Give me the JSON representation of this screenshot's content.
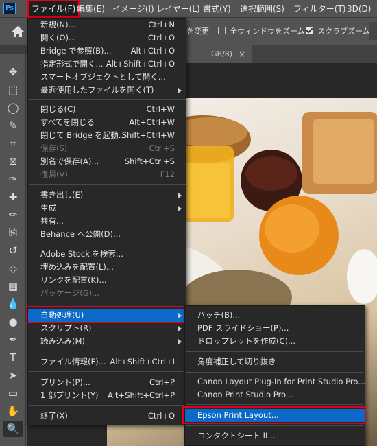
{
  "app": {
    "logo": "Ps"
  },
  "menubar": {
    "items": [
      "ファイル(F)",
      "編集(E)",
      "イメージ(I)",
      "レイヤー(L)",
      "書式(Y)",
      "選択範囲(S)",
      "フィルター(T)",
      "3D(D)"
    ],
    "active_index": 0
  },
  "options": {
    "home_icon": "home-icon",
    "partial_text": "を変更",
    "zoom_all_windows": {
      "label": "全ウィンドウをズーム",
      "checked": false
    },
    "scrubby_zoom": {
      "label": "スクラブズーム",
      "checked": true
    }
  },
  "document": {
    "tab_partial_title": "GB/8)",
    "close_glyph": "×"
  },
  "tools": [
    "move-tool",
    "marquee-tool",
    "lasso-tool",
    "quick-selection-tool",
    "crop-tool",
    "frame-tool",
    "eyedropper-tool",
    "healing-brush-tool",
    "brush-tool",
    "clone-stamp-tool",
    "history-brush-tool",
    "eraser-tool",
    "gradient-tool",
    "blur-tool",
    "dodge-tool",
    "pen-tool",
    "type-tool",
    "path-selection-tool",
    "rectangle-tool",
    "hand-tool",
    "zoom-tool"
  ],
  "tool_glyphs": [
    "✥",
    "⬚",
    "◯",
    "✎",
    "⌗",
    "⊠",
    "✑",
    "✚",
    "✏",
    "⎘",
    "↺",
    "◇",
    "▦",
    "💧",
    "●",
    "✒",
    "T",
    "➤",
    "▭",
    "✋",
    "🔍"
  ],
  "selected_tool": "zoom-tool",
  "file_menu": {
    "items": [
      {
        "label": "新規(N)...",
        "shortcut": "Ctrl+N"
      },
      {
        "label": "開く(O)...",
        "shortcut": "Ctrl+O"
      },
      {
        "label": "Bridge で参照(B)...",
        "shortcut": "Alt+Ctrl+O"
      },
      {
        "label": "指定形式で開く...",
        "shortcut": "Alt+Shift+Ctrl+O"
      },
      {
        "label": "スマートオブジェクトとして開く..."
      },
      {
        "label": "最近使用したファイルを開く(T)",
        "submenu": true
      },
      {
        "label": "閉じる(C)",
        "shortcut": "Ctrl+W"
      },
      {
        "label": "すべてを閉じる",
        "shortcut": "Alt+Ctrl+W"
      },
      {
        "label": "閉じて Bridge を起動...",
        "shortcut": "Shift+Ctrl+W"
      },
      {
        "label": "保存(S)",
        "shortcut": "Ctrl+S",
        "disabled": true
      },
      {
        "label": "別名で保存(A)...",
        "shortcut": "Shift+Ctrl+S"
      },
      {
        "label": "復帰(V)",
        "shortcut": "F12",
        "disabled": true
      },
      {
        "label": "書き出し(E)",
        "submenu": true
      },
      {
        "label": "生成",
        "submenu": true
      },
      {
        "label": "共有..."
      },
      {
        "label": "Behance へ公開(D)..."
      },
      {
        "label": "Adobe Stock を検索..."
      },
      {
        "label": "埋め込みを配置(L)..."
      },
      {
        "label": "リンクを配置(K)..."
      },
      {
        "label": "パッケージ(G)...",
        "disabled": true
      },
      {
        "label": "自動処理(U)",
        "submenu": true,
        "highlighted": true
      },
      {
        "label": "スクリプト(R)",
        "submenu": true
      },
      {
        "label": "読み込み(M)",
        "submenu": true
      },
      {
        "label": "ファイル情報(F)...",
        "shortcut": "Alt+Shift+Ctrl+I"
      },
      {
        "label": "プリント(P)...",
        "shortcut": "Ctrl+P"
      },
      {
        "label": "1 部プリント(Y)",
        "shortcut": "Alt+Shift+Ctrl+P"
      },
      {
        "label": "終了(X)",
        "shortcut": "Ctrl+Q"
      }
    ]
  },
  "automate_submenu": {
    "items": [
      {
        "label": "バッチ(B)..."
      },
      {
        "label": "PDF スライドショー(P)..."
      },
      {
        "label": "ドロップレットを作成(C)..."
      },
      {
        "label": "角度補正して切り抜き"
      },
      {
        "label": "Canon Layout Plug-In for Print Studio Pro..."
      },
      {
        "label": "Canon Print Studio Pro..."
      },
      {
        "label": "Epson Print Layout...",
        "highlighted": true
      },
      {
        "label": "コンタクトシート II..."
      }
    ]
  },
  "colors": {
    "highlight": "#0b69c7",
    "callout": "#e3001b",
    "menu_bg": "#282828",
    "ui_bg": "#535353"
  }
}
